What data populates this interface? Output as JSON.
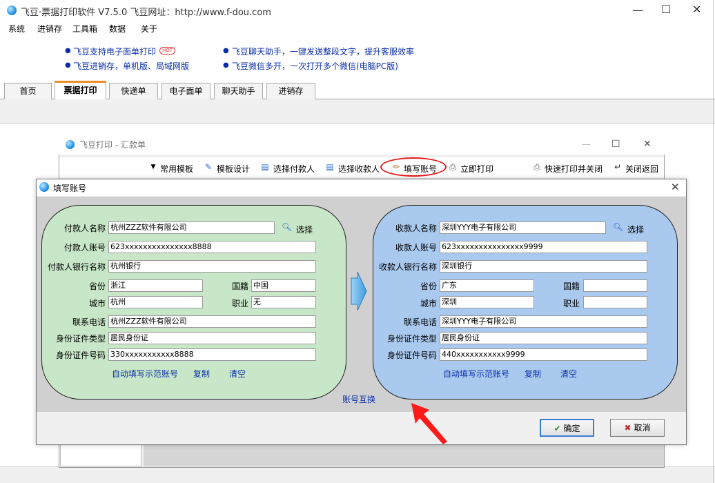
{
  "main_window": {
    "title": "飞豆·票据打印软件 V7.5.0   飞豆网址：http://www.f-dou.com",
    "menu": [
      "系统",
      "进销存",
      "工具箱",
      "数据",
      "关于"
    ],
    "ads": {
      "ad1": "飞豆支持电子面单打印",
      "ad1_badge": "HOT",
      "ad2": "飞豆进销存，单机版、局域网版",
      "ad3": "飞豆聊天助手，一键发送整段文字，提升客服效率",
      "ad4": "飞豆微信多开，一次打开多个微信(电脑PC版)"
    },
    "tabs": [
      {
        "label": "首页"
      },
      {
        "label": "票据打印",
        "active": true
      },
      {
        "label": "快递单"
      },
      {
        "label": "电子面单"
      },
      {
        "label": "聊天助手"
      },
      {
        "label": "进销存"
      }
    ]
  },
  "remit_window": {
    "title": "飞豆打印 - 汇款单",
    "toolbar": {
      "common_templates": "常用模板",
      "template_design": "模板设计",
      "select_payer": "选择付款人",
      "select_payee": "选择收款人",
      "fill_account": "填写账号",
      "print_now": "立即打印",
      "quick_print_close": "快速打印并关闭",
      "close_return": "关闭返回"
    }
  },
  "dialog": {
    "title": "填写账号",
    "payer": {
      "labels": {
        "name": "付款人名称",
        "account": "付款人账号",
        "bank": "付款人银行名称",
        "province": "省份",
        "nationality": "国籍",
        "city": "城市",
        "occupation": "职业",
        "phone": "联系电话",
        "id_type": "身份证件类型",
        "id_number": "身份证件号码"
      },
      "values": {
        "name": "杭州ZZZ软件有限公司",
        "account": "623xxxxxxxxxxxxxxx8888",
        "bank": "杭州银行",
        "province": "浙江",
        "nationality": "中国",
        "city": "杭州",
        "occupation": "无",
        "phone": "杭州ZZZ软件有限公司",
        "id_type": "居民身份证",
        "id_number": "330xxxxxxxxxxx8888"
      },
      "select_label": "选择",
      "links": {
        "auto_fill": "自动填写示范账号",
        "copy": "复制",
        "clear": "清空"
      }
    },
    "payee": {
      "labels": {
        "name": "收款人名称",
        "account": "收款人账号",
        "bank": "收款人银行名称",
        "province": "省份",
        "nationality": "国籍",
        "city": "城市",
        "occupation": "职业",
        "phone": "联系电话",
        "id_type": "身份证件类型",
        "id_number": "身份证件号码"
      },
      "values": {
        "name": "深圳YYY电子有限公司",
        "account": "623xxxxxxxxxxxxxxx9999",
        "bank": "深圳银行",
        "province": "广东",
        "nationality": "",
        "city": "深圳",
        "occupation": "",
        "phone": "深圳YYY电子有限公司",
        "id_type": "居民身份证",
        "id_number": "440xxxxxxxxxxx9999"
      },
      "select_label": "选择",
      "links": {
        "auto_fill": "自动填写示范账号",
        "copy": "复制",
        "clear": "清空"
      }
    },
    "swap_label": "账号互换",
    "ok_label": "确定",
    "cancel_label": "取消"
  },
  "colors": {
    "payer_panel": "#c8e6c8",
    "payee_panel": "#a9c9ef",
    "link": "#0a2ea8",
    "highlight": "#e8191a",
    "active_tab_accent": "#f08a24"
  }
}
